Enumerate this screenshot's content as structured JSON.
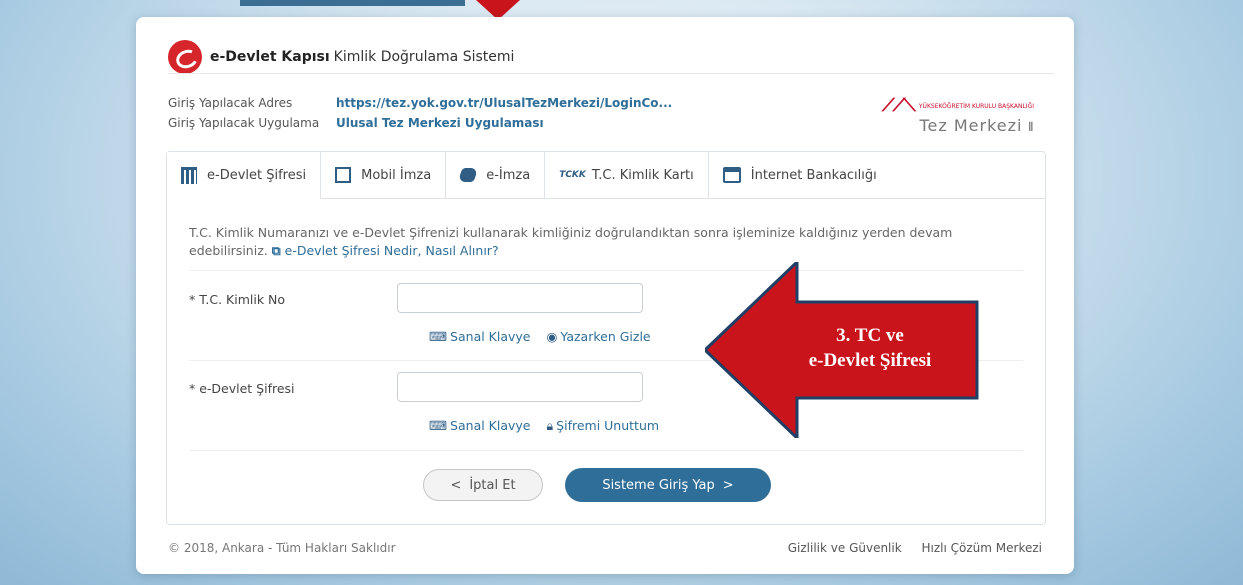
{
  "brand": {
    "strong": "e-Devlet Kapısı",
    "rest": "Kimlik Doğrulama Sistemi"
  },
  "info": {
    "address_label": "Giriş Yapılacak Adres",
    "address_value": "https://tez.yok.gov.tr/UlusalTezMerkezi/LoginCo...",
    "app_label": "Giriş Yapılacak Uygulama",
    "app_value": "Ulusal Tez Merkezi Uygulaması"
  },
  "partner": {
    "logo_text": "YÖK",
    "logo_small": "YÜKSEKÖĞRETİM KURULU BAŞKANLIĞI",
    "name": "Tez Merkezi"
  },
  "tabs": [
    {
      "label": "e-Devlet Şifresi",
      "icon": "keypad-icon"
    },
    {
      "label": "Mobil İmza",
      "icon": "mobile-signature-icon"
    },
    {
      "label": "e-İmza",
      "icon": "e-signature-icon"
    },
    {
      "label": "T.C. Kimlik Kartı",
      "icon": "id-card-icon",
      "badge": "TCKK"
    },
    {
      "label": "İnternet Bankacılığı",
      "icon": "bank-card-icon"
    }
  ],
  "description": {
    "text": "T.C. Kimlik Numaranızı ve e-Devlet Şifrenizi kullanarak kimliğiniz doğrulandıktan sonra işleminize kaldığınız yerden devam edebilirsiniz.",
    "link": "e-Devlet Şifresi Nedir, Nasıl Alınır?"
  },
  "form": {
    "tc_label": "* T.C. Kimlik No",
    "tc_value": "",
    "password_label": "* e-Devlet Şifresi",
    "password_value": "",
    "virtual_keyboard": "Sanal Klavye",
    "hide_while_typing": "Yazarken Gizle",
    "forgot_password": "Şifremi Unuttum"
  },
  "buttons": {
    "cancel": "İptal Et",
    "login": "Sisteme Giriş Yap"
  },
  "footer": {
    "copyright": "© 2018, Ankara - Tüm Hakları Saklıdır",
    "privacy": "Gizlilik ve Güvenlik",
    "help": "Hızlı Çözüm Merkezi"
  },
  "annotation": {
    "line1": "3. TC ve",
    "line2": "e-Devlet Şifresi",
    "color": "#c9141b"
  }
}
